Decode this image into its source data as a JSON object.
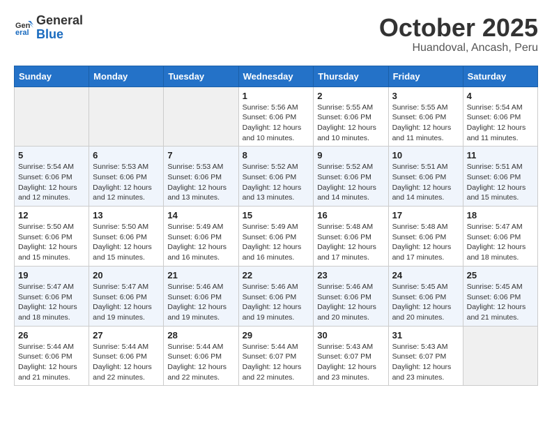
{
  "header": {
    "logo_general": "General",
    "logo_blue": "Blue",
    "month": "October 2025",
    "location": "Huandoval, Ancash, Peru"
  },
  "days_of_week": [
    "Sunday",
    "Monday",
    "Tuesday",
    "Wednesday",
    "Thursday",
    "Friday",
    "Saturday"
  ],
  "weeks": [
    [
      {
        "day": "",
        "info": ""
      },
      {
        "day": "",
        "info": ""
      },
      {
        "day": "",
        "info": ""
      },
      {
        "day": "1",
        "info": "Sunrise: 5:56 AM\nSunset: 6:06 PM\nDaylight: 12 hours and 10 minutes."
      },
      {
        "day": "2",
        "info": "Sunrise: 5:55 AM\nSunset: 6:06 PM\nDaylight: 12 hours and 10 minutes."
      },
      {
        "day": "3",
        "info": "Sunrise: 5:55 AM\nSunset: 6:06 PM\nDaylight: 12 hours and 11 minutes."
      },
      {
        "day": "4",
        "info": "Sunrise: 5:54 AM\nSunset: 6:06 PM\nDaylight: 12 hours and 11 minutes."
      }
    ],
    [
      {
        "day": "5",
        "info": "Sunrise: 5:54 AM\nSunset: 6:06 PM\nDaylight: 12 hours and 12 minutes."
      },
      {
        "day": "6",
        "info": "Sunrise: 5:53 AM\nSunset: 6:06 PM\nDaylight: 12 hours and 12 minutes."
      },
      {
        "day": "7",
        "info": "Sunrise: 5:53 AM\nSunset: 6:06 PM\nDaylight: 12 hours and 13 minutes."
      },
      {
        "day": "8",
        "info": "Sunrise: 5:52 AM\nSunset: 6:06 PM\nDaylight: 12 hours and 13 minutes."
      },
      {
        "day": "9",
        "info": "Sunrise: 5:52 AM\nSunset: 6:06 PM\nDaylight: 12 hours and 14 minutes."
      },
      {
        "day": "10",
        "info": "Sunrise: 5:51 AM\nSunset: 6:06 PM\nDaylight: 12 hours and 14 minutes."
      },
      {
        "day": "11",
        "info": "Sunrise: 5:51 AM\nSunset: 6:06 PM\nDaylight: 12 hours and 15 minutes."
      }
    ],
    [
      {
        "day": "12",
        "info": "Sunrise: 5:50 AM\nSunset: 6:06 PM\nDaylight: 12 hours and 15 minutes."
      },
      {
        "day": "13",
        "info": "Sunrise: 5:50 AM\nSunset: 6:06 PM\nDaylight: 12 hours and 15 minutes."
      },
      {
        "day": "14",
        "info": "Sunrise: 5:49 AM\nSunset: 6:06 PM\nDaylight: 12 hours and 16 minutes."
      },
      {
        "day": "15",
        "info": "Sunrise: 5:49 AM\nSunset: 6:06 PM\nDaylight: 12 hours and 16 minutes."
      },
      {
        "day": "16",
        "info": "Sunrise: 5:48 AM\nSunset: 6:06 PM\nDaylight: 12 hours and 17 minutes."
      },
      {
        "day": "17",
        "info": "Sunrise: 5:48 AM\nSunset: 6:06 PM\nDaylight: 12 hours and 17 minutes."
      },
      {
        "day": "18",
        "info": "Sunrise: 5:47 AM\nSunset: 6:06 PM\nDaylight: 12 hours and 18 minutes."
      }
    ],
    [
      {
        "day": "19",
        "info": "Sunrise: 5:47 AM\nSunset: 6:06 PM\nDaylight: 12 hours and 18 minutes."
      },
      {
        "day": "20",
        "info": "Sunrise: 5:47 AM\nSunset: 6:06 PM\nDaylight: 12 hours and 19 minutes."
      },
      {
        "day": "21",
        "info": "Sunrise: 5:46 AM\nSunset: 6:06 PM\nDaylight: 12 hours and 19 minutes."
      },
      {
        "day": "22",
        "info": "Sunrise: 5:46 AM\nSunset: 6:06 PM\nDaylight: 12 hours and 19 minutes."
      },
      {
        "day": "23",
        "info": "Sunrise: 5:46 AM\nSunset: 6:06 PM\nDaylight: 12 hours and 20 minutes."
      },
      {
        "day": "24",
        "info": "Sunrise: 5:45 AM\nSunset: 6:06 PM\nDaylight: 12 hours and 20 minutes."
      },
      {
        "day": "25",
        "info": "Sunrise: 5:45 AM\nSunset: 6:06 PM\nDaylight: 12 hours and 21 minutes."
      }
    ],
    [
      {
        "day": "26",
        "info": "Sunrise: 5:44 AM\nSunset: 6:06 PM\nDaylight: 12 hours and 21 minutes."
      },
      {
        "day": "27",
        "info": "Sunrise: 5:44 AM\nSunset: 6:06 PM\nDaylight: 12 hours and 22 minutes."
      },
      {
        "day": "28",
        "info": "Sunrise: 5:44 AM\nSunset: 6:06 PM\nDaylight: 12 hours and 22 minutes."
      },
      {
        "day": "29",
        "info": "Sunrise: 5:44 AM\nSunset: 6:07 PM\nDaylight: 12 hours and 22 minutes."
      },
      {
        "day": "30",
        "info": "Sunrise: 5:43 AM\nSunset: 6:07 PM\nDaylight: 12 hours and 23 minutes."
      },
      {
        "day": "31",
        "info": "Sunrise: 5:43 AM\nSunset: 6:07 PM\nDaylight: 12 hours and 23 minutes."
      },
      {
        "day": "",
        "info": ""
      }
    ]
  ]
}
